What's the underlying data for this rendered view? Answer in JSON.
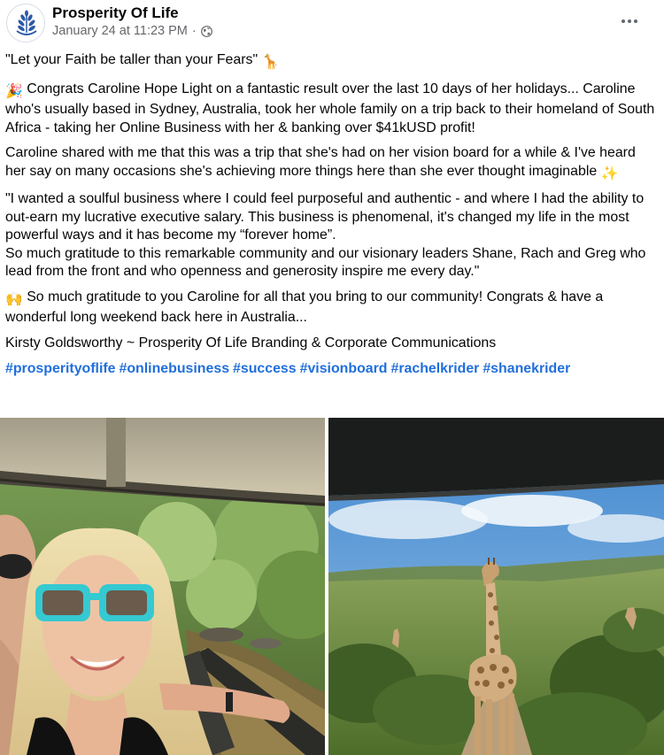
{
  "header": {
    "page_name": "Prosperity Of Life",
    "timestamp": "January 24 at 11:23 PM",
    "separator": "·",
    "privacy_icon": "globe-icon",
    "more_icon": "more-options-icon"
  },
  "post": {
    "paragraphs": [
      {
        "emoji_before": "",
        "text": "\"Let your Faith be taller than your Fears\" ",
        "emoji_after": "🦒"
      },
      {
        "emoji_before": "🎉",
        "text": " Congrats Caroline Hope Light on a fantastic result over the last 10 days of her holidays... Caroline who's usually based in Sydney, Australia, took her whole family on a trip back to their homeland of South Africa - taking her Online Business with her & banking over $41kUSD profit!",
        "emoji_after": ""
      },
      {
        "emoji_before": "",
        "text": "Caroline shared with me that this was a trip that she's had on her vision board for a while & I've heard her say on many occasions she's achieving more things here than she ever thought imaginable ",
        "emoji_after": "✨"
      },
      {
        "emoji_before": "",
        "text": "\"I wanted a soulful business where I could feel purposeful and authentic - and where I had the ability to out-earn my lucrative executive salary. This business is phenomenal, it's changed my life in the most powerful ways and it has become my “forever home”.",
        "emoji_after": ""
      },
      {
        "emoji_before": "",
        "text": "So much gratitude to this remarkable community and our visionary leaders Shane, Rach and Greg who lead from the front and who openness and generosity inspire me every day.\"",
        "emoji_after": ""
      },
      {
        "emoji_before": "🙌",
        "text": " So much gratitude to you Caroline for all that you bring to our community! Congrats & have a wonderful long weekend back here in Australia...",
        "emoji_after": ""
      },
      {
        "emoji_before": "",
        "text": "Kirsty Goldsworthy ~ Prosperity Of Life Branding & Corporate Communications",
        "emoji_after": ""
      }
    ],
    "hashtags": [
      "#prosperityoflife",
      "#onlinebusiness",
      "#success",
      "#visionboard",
      "#rachelkrider",
      "#shanekrider"
    ]
  },
  "photos": [
    {
      "name": "selfie-photo",
      "icon": "woman-sunglasses-safari-selfie"
    },
    {
      "name": "giraffe-photo",
      "icon": "giraffe-savanna-landscape"
    }
  ],
  "colors": {
    "text": "#050505",
    "secondary_text": "#65676b",
    "hashtag": "#216fdb",
    "brand_blue": "#2d5aa6"
  }
}
